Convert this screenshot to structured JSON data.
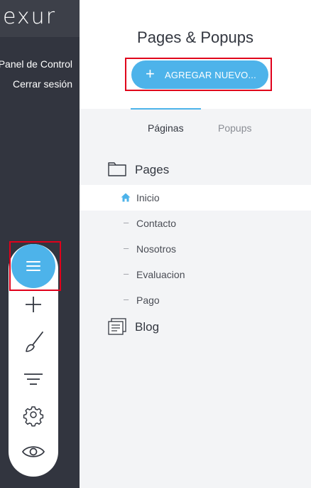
{
  "sidebar": {
    "logo": "exur",
    "links": [
      "Panel de Control",
      "Cerrar sesión"
    ]
  },
  "toolbar": {
    "icons": [
      "menu-icon",
      "plus-icon",
      "brush-icon",
      "filter-icon",
      "gear-icon",
      "eye-icon"
    ]
  },
  "panel": {
    "title": "Pages & Popups",
    "add_button": {
      "icon": "+",
      "label": "AGREGAR NUEVO..."
    },
    "tabs": [
      {
        "label": "Páginas",
        "active": true
      },
      {
        "label": "Popups",
        "active": false
      }
    ],
    "groups": [
      {
        "label": "Pages",
        "icon": "folder-icon"
      },
      {
        "label": "Blog",
        "icon": "blog-icon"
      }
    ],
    "pages": [
      {
        "name": "Inicio",
        "marker": "home-icon",
        "selected": true
      },
      {
        "name": "Contacto",
        "marker": "–",
        "selected": false
      },
      {
        "name": "Nosotros",
        "marker": "–",
        "selected": false
      },
      {
        "name": "Evaluacion",
        "marker": "–",
        "selected": false
      },
      {
        "name": "Pago",
        "marker": "–",
        "selected": false
      }
    ]
  },
  "colors": {
    "accent": "#4db3ea",
    "sidebar_bg": "#32353f",
    "highlight": "#e0001b"
  }
}
